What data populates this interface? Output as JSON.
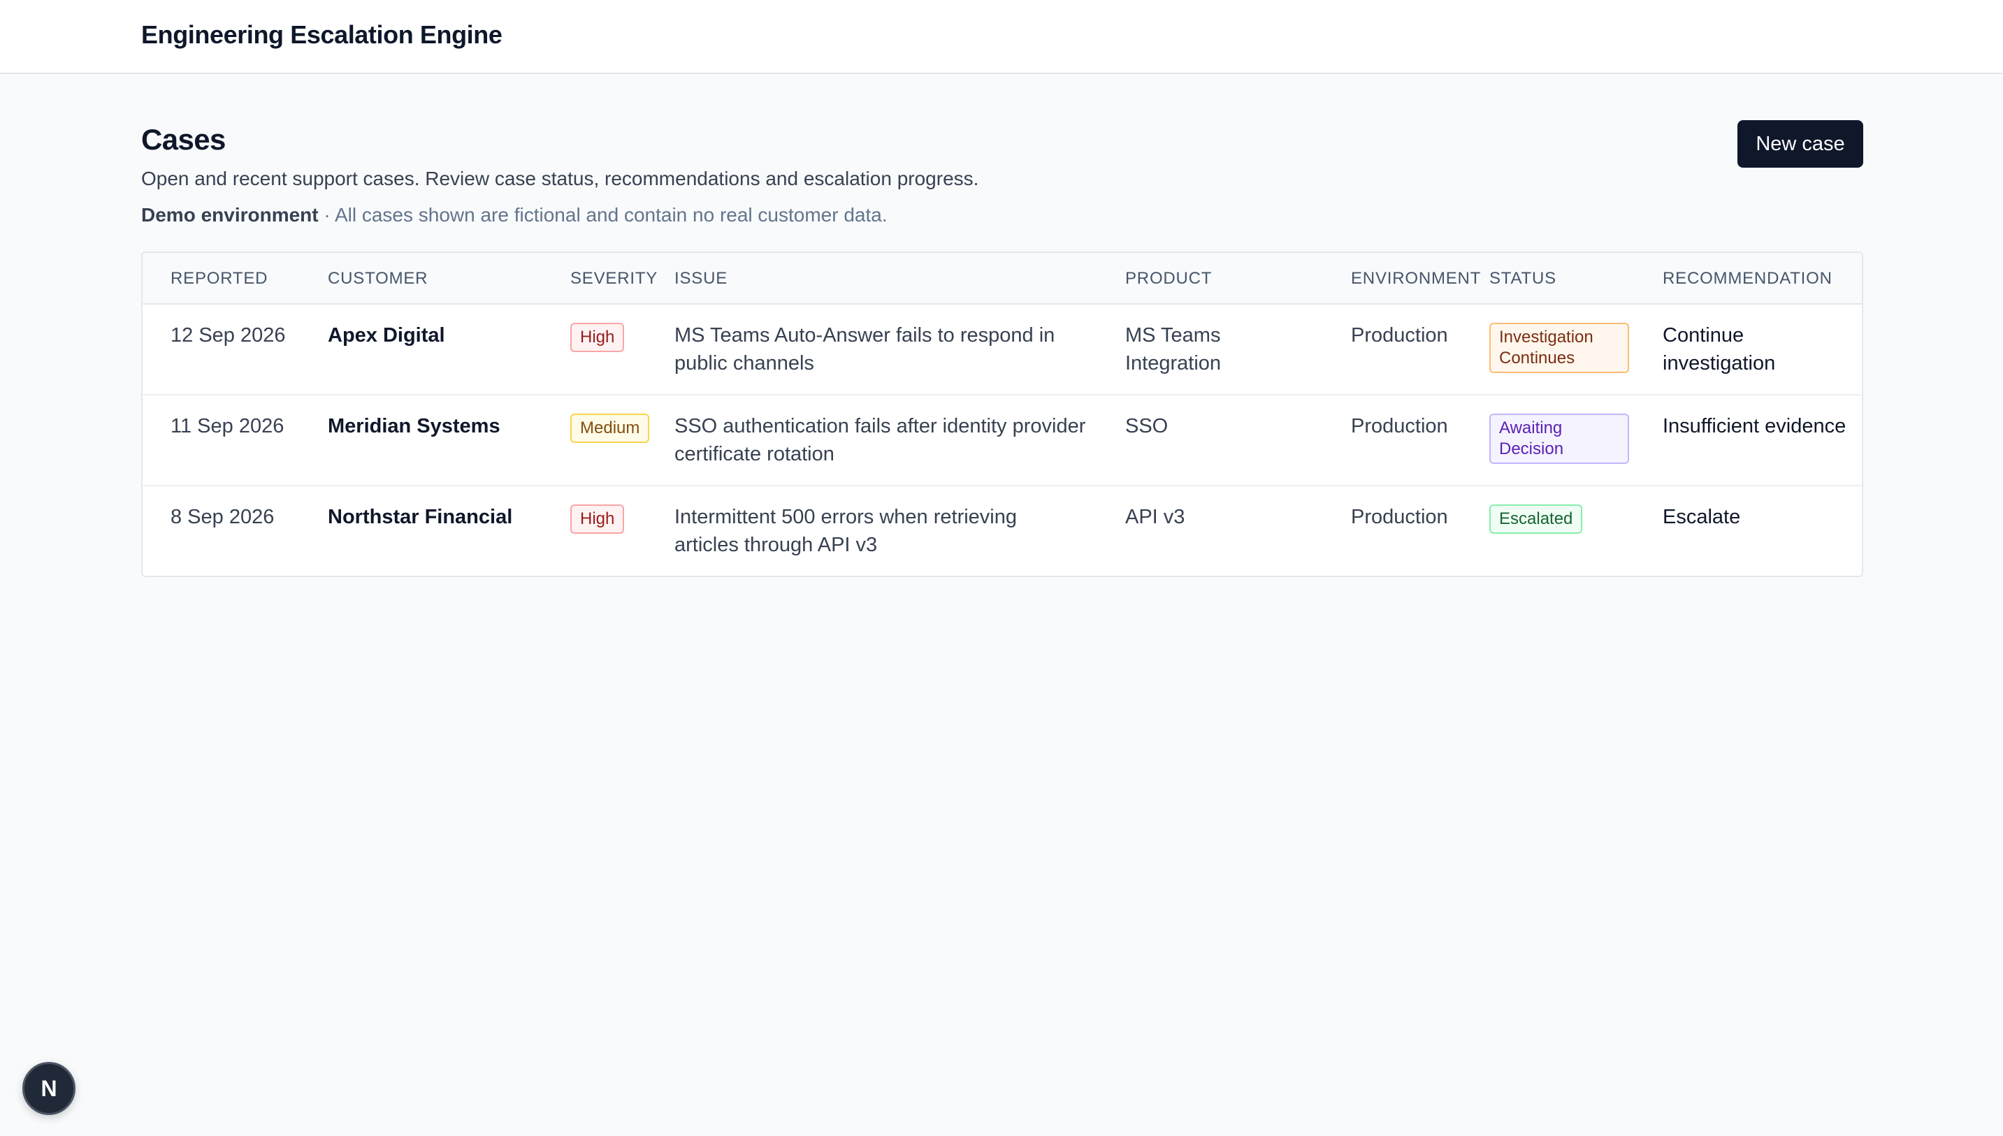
{
  "app": {
    "title": "Engineering Escalation Engine"
  },
  "page": {
    "title": "Cases",
    "description": "Open and recent support cases. Review case status, recommendations and escalation progress.",
    "demo_label": "Demo environment",
    "demo_note": " · All cases shown are fictional and contain no real customer data.",
    "new_case_label": "New case"
  },
  "table": {
    "columns": [
      "Reported",
      "Customer",
      "Severity",
      "Issue",
      "Product",
      "Environment",
      "Status",
      "Recommendation"
    ],
    "rows": [
      {
        "reported": "12 Sep 2026",
        "customer": "Apex Digital",
        "severity": "High",
        "issue": "MS Teams Auto-Answer fails to respond in public channels",
        "product": "MS Teams Integration",
        "environment": "Production",
        "status": "Investigation Continues",
        "recommendation": "Continue investigation"
      },
      {
        "reported": "11 Sep 2026",
        "customer": "Meridian Systems",
        "severity": "Medium",
        "issue": "SSO authentication fails after identity provider certificate rotation",
        "product": "SSO",
        "environment": "Production",
        "status": "Awaiting Decision",
        "recommendation": "Insufficient evidence"
      },
      {
        "reported": "8 Sep 2026",
        "customer": "Northstar Financial",
        "severity": "High",
        "issue": "Intermittent 500 errors when retrieving articles through API v3",
        "product": "API v3",
        "environment": "Production",
        "status": "Escalated",
        "recommendation": "Escalate"
      }
    ]
  },
  "framework_badge": {
    "letter": "N",
    "icon": "nextjs-icon"
  },
  "colors": {
    "primary": "#0f172a",
    "background": "#f8fafc",
    "high": "#991b1b",
    "medium": "#854d0e",
    "investigation": "#7c2d12",
    "awaiting": "#5b21b6",
    "escalated": "#166534"
  }
}
